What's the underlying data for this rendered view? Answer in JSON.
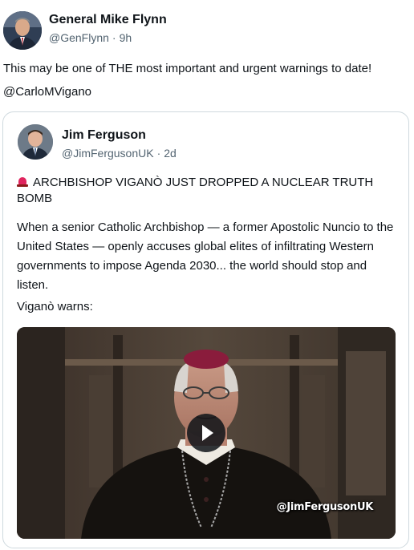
{
  "post": {
    "author_name": "General Mike Flynn",
    "author_handle": "@GenFlynn",
    "separator": "·",
    "time": "9h",
    "text": "This may be one of THE most important and urgent warnings to date!",
    "mention": "@CarloMVigano"
  },
  "quote": {
    "author_name": "Jim Ferguson",
    "author_handle": "@JimFergusonUK",
    "separator": "·",
    "time": "2d",
    "headline_icon": "police-siren-icon",
    "headline": "ARCHBISHOP VIGANÒ JUST DROPPED A NUCLEAR TRUTH BOMB",
    "body": "When a senior Catholic Archbishop — a former Apostolic Nuncio to the United States — openly accuses global elites of infiltrating Western governments to impose Agenda 2030... the world should stop and listen.",
    "warns": "Viganò warns:",
    "video": {
      "watermark": "@JimFergusonUK",
      "play_icon": "play-icon"
    }
  }
}
